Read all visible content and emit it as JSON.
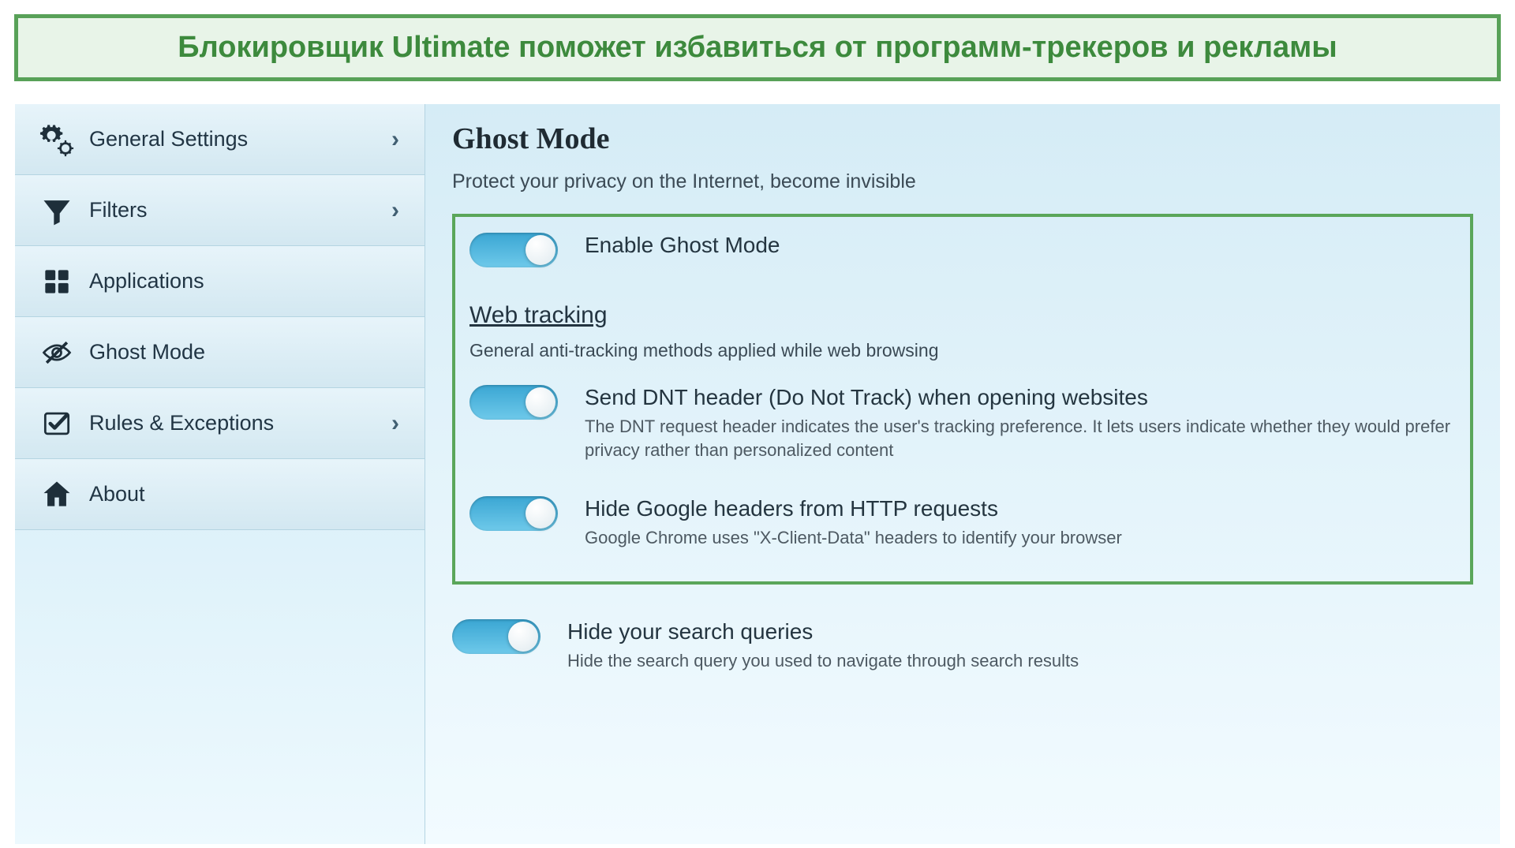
{
  "banner": {
    "text": "Блокировщик Ultimate поможет избавиться от программ-трекеров и рекламы"
  },
  "sidebar": {
    "items": [
      {
        "label": "General Settings",
        "chevron": true,
        "icon": "gears-icon"
      },
      {
        "label": "Filters",
        "chevron": true,
        "icon": "funnel-icon"
      },
      {
        "label": "Applications",
        "chevron": false,
        "icon": "apps-icon"
      },
      {
        "label": "Ghost Mode",
        "chevron": false,
        "icon": "eye-slash-icon"
      },
      {
        "label": "Rules & Exceptions",
        "chevron": true,
        "icon": "check-icon"
      },
      {
        "label": "About",
        "chevron": false,
        "icon": "home-icon"
      }
    ],
    "chevron_glyph": "›"
  },
  "main": {
    "title": "Ghost Mode",
    "subtitle": "Protect your privacy on the Internet, become invisible",
    "enable_row": {
      "title": "Enable Ghost Mode"
    },
    "section": {
      "heading": "Web tracking",
      "subheading": "General anti-tracking methods applied while web browsing"
    },
    "rows": [
      {
        "title": "Send DNT header (Do Not Track) when opening websites",
        "desc": "The DNT request header indicates the user's tracking preference. It lets users indicate whether they would prefer privacy rather than personalized content"
      },
      {
        "title": "Hide Google headers from HTTP requests",
        "desc": "Google Chrome uses \"X-Client-Data\" headers to identify your browser"
      },
      {
        "title": "Hide your search queries",
        "desc": "Hide the search query you used to navigate through search results"
      }
    ]
  }
}
